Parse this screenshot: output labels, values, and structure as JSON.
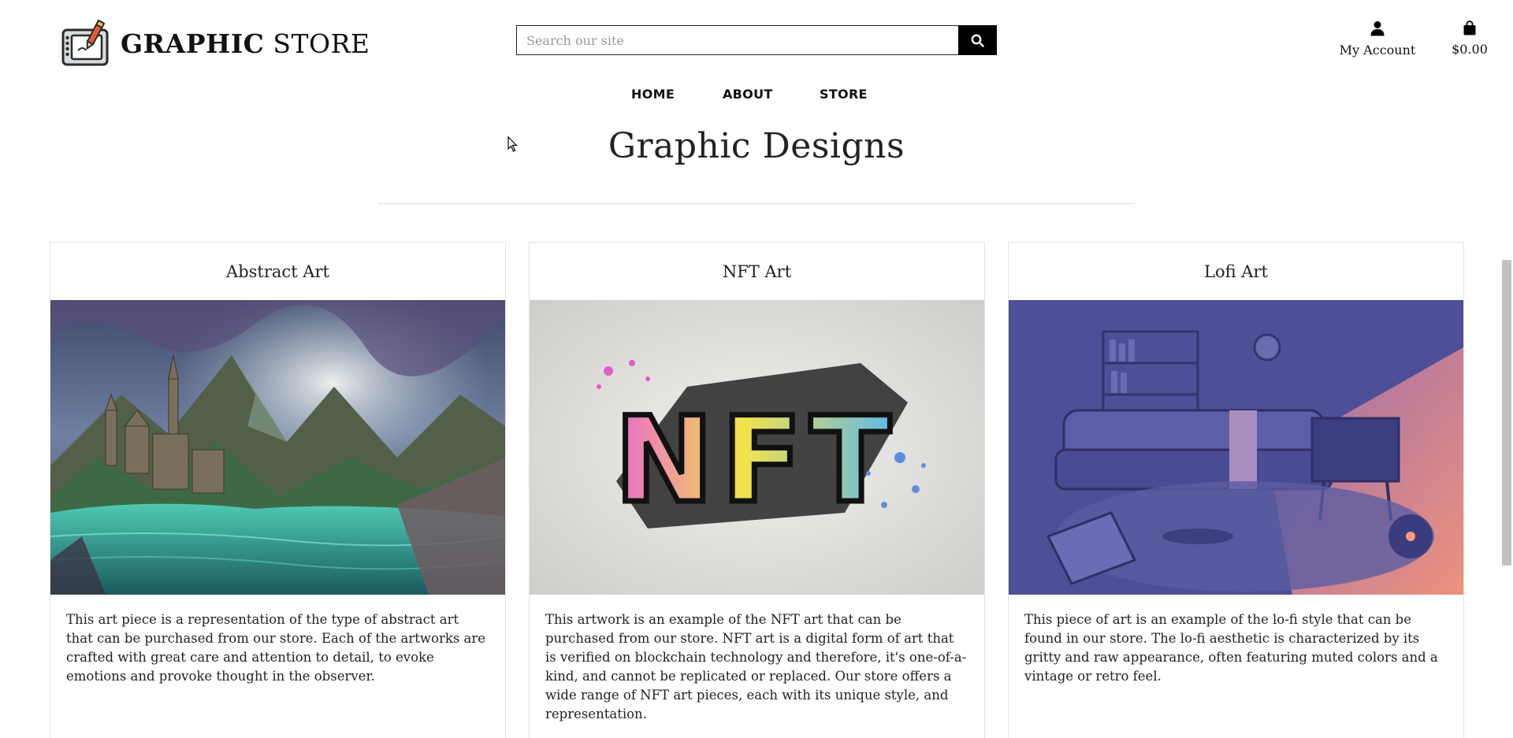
{
  "header": {
    "logo_bold": "GRAPHIC",
    "logo_light": "STORE",
    "search_placeholder": "Search our site",
    "account_label": "My Account",
    "cart_label": "$0.00"
  },
  "nav": {
    "items": [
      {
        "label": "HOME"
      },
      {
        "label": "ABOUT"
      },
      {
        "label": "STORE"
      }
    ]
  },
  "main": {
    "title": "Graphic Designs",
    "cards": [
      {
        "title": "Abstract Art",
        "description": "This art piece is a representation of the type of abstract art that can be purchased from our store. Each of the artworks are crafted with great care and attention to detail, to evoke emotions and provoke thought in the observer."
      },
      {
        "title": "NFT Art",
        "image_text": "NFT",
        "description": "This artwork is an example of the NFT art that can be purchased from our store. NFT art is a digital form of art that is verified on blockchain technology and therefore, it's one-of-a-kind, and cannot be replicated or replaced. Our store offers a wide range of NFT art pieces, each with its unique style, and representation."
      },
      {
        "title": "Lofi Art",
        "description": "This piece of art is an example of the lo-fi style that can be found in our store. The lo-fi aesthetic is characterized by its gritty and raw appearance, often featuring muted colors and a vintage or retro feel."
      }
    ]
  },
  "icons": {
    "logo": "drawing-tablet-icon",
    "search": "search-icon",
    "account": "user-icon",
    "cart": "shopping-bag-icon"
  }
}
